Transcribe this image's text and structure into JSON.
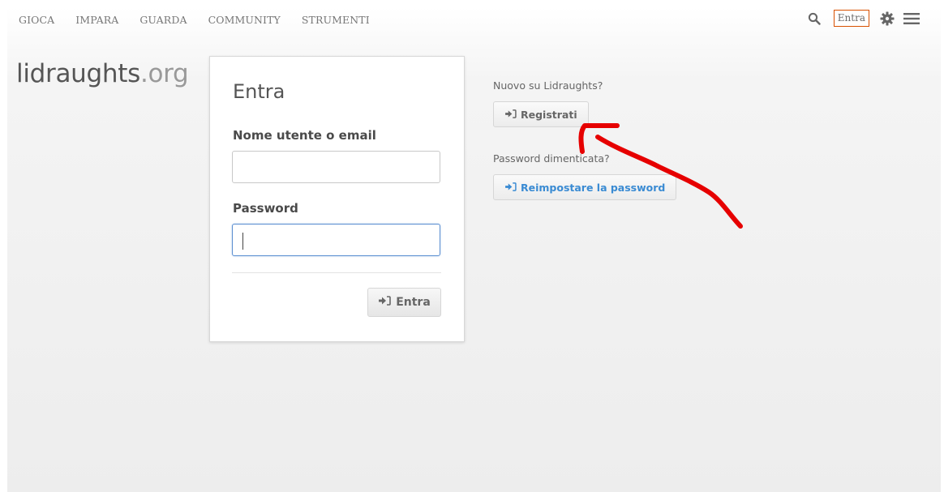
{
  "nav": {
    "items": [
      {
        "label": "GIOCA"
      },
      {
        "label": "IMPARA"
      },
      {
        "label": "GUARDA"
      },
      {
        "label": "COMMUNITY"
      },
      {
        "label": "STRUMENTI"
      }
    ],
    "signin_label": "Entra",
    "icons": [
      "search-icon",
      "gear-icon",
      "hamburger-menu-icon"
    ]
  },
  "logo": {
    "name": "lidraughts",
    "tld": ".org"
  },
  "login": {
    "title": "Entra",
    "username_label": "Nome utente o email",
    "username_value": "",
    "password_label": "Password",
    "password_value": "",
    "submit_label": "Entra"
  },
  "side": {
    "new_user_text": "Nuovo su Lidraughts?",
    "register_label": "Registrati",
    "forgot_text": "Password dimenticata?",
    "reset_label": "Reimpostare la password"
  },
  "colors": {
    "accent_orange": "#d85000",
    "link_blue": "#3a8bd3",
    "annotation_red": "#e60000"
  }
}
